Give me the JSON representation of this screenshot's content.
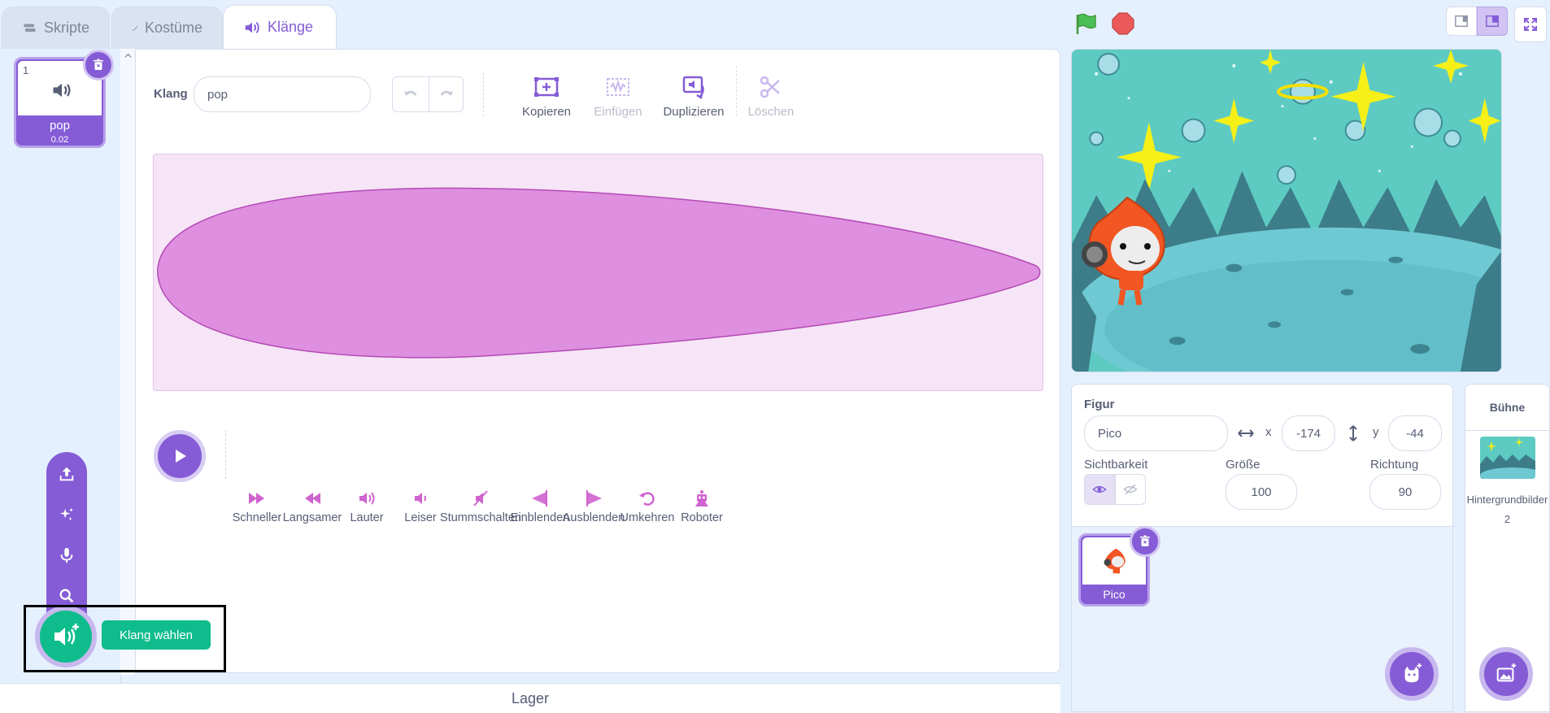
{
  "tabs": [
    {
      "label": "Skripte",
      "icon": "code-icon"
    },
    {
      "label": "Kostüme",
      "icon": "brush-icon"
    },
    {
      "label": "Klänge",
      "icon": "speaker-icon"
    }
  ],
  "sound_list": {
    "items": [
      {
        "number": "1",
        "name": "pop",
        "duration": "0.02"
      }
    ]
  },
  "editor": {
    "name_label": "Klang",
    "name_value": "pop",
    "tools": [
      {
        "label": "Kopieren",
        "icon": "copy-icon",
        "enabled": true
      },
      {
        "label": "Einfügen",
        "icon": "paste-icon",
        "enabled": false
      },
      {
        "label": "Duplizieren",
        "icon": "duplicate-icon",
        "enabled": true
      },
      {
        "label": "Löschen",
        "icon": "scissors-icon",
        "enabled": false
      }
    ],
    "effects": [
      "Schneller",
      "Langsamer",
      "Lauter",
      "Leiser",
      "Stummschalten",
      "Einblenden",
      "Ausblenden",
      "Umkehren",
      "Roboter"
    ]
  },
  "menu": {
    "tooltip": "Klang wählen",
    "items": [
      "upload-icon",
      "surprise-icon",
      "record-icon",
      "search-icon"
    ]
  },
  "lager_label": "Lager",
  "sprite_info": {
    "figur_label": "Figur",
    "figur_name": "Pico",
    "x_label": "x",
    "x_value": "-174",
    "y_label": "y",
    "y_value": "-44",
    "visibility_label": "Sichtbarkeit",
    "size_label": "Größe",
    "size_value": "100",
    "direction_label": "Richtung",
    "direction_value": "90"
  },
  "sprites": [
    {
      "name": "Pico"
    }
  ],
  "stage_pane": {
    "title": "Bühne",
    "backdrops_label": "Hintergrundbilder",
    "backdrops_count": "2"
  },
  "colors": {
    "accent": "#855cd6",
    "green": "#0fbd8c",
    "waveform": "#e090e0"
  }
}
